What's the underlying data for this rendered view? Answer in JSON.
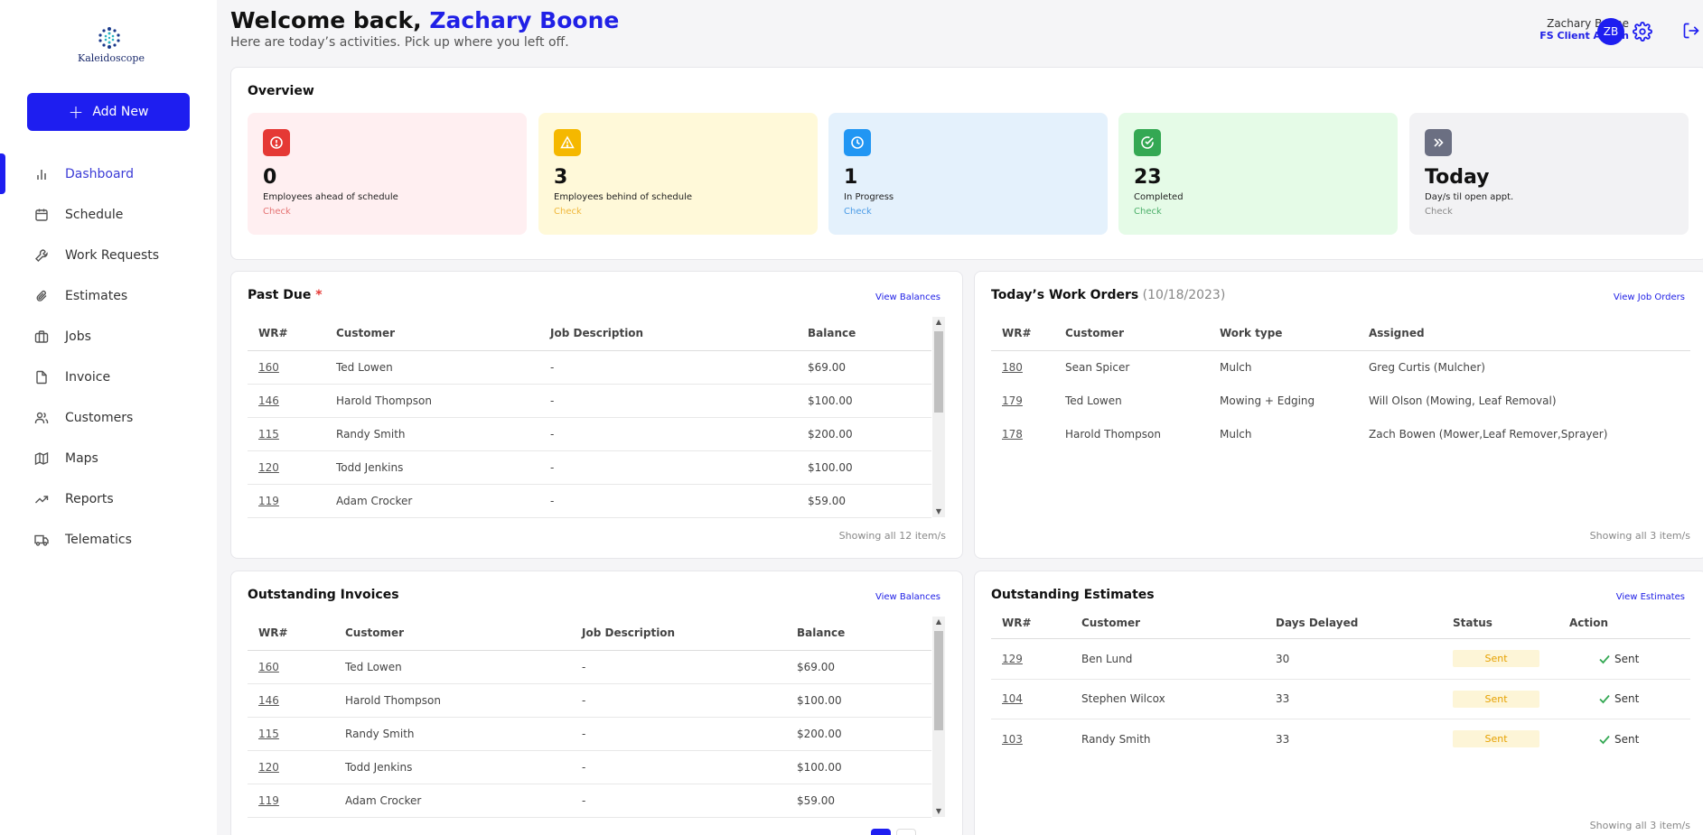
{
  "app": {
    "logo_text": "Kaleidoscope"
  },
  "sidebar": {
    "add_new_label": "Add New",
    "items": [
      {
        "label": "Dashboard",
        "icon": "bar-chart-icon"
      },
      {
        "label": "Schedule",
        "icon": "calendar-icon"
      },
      {
        "label": "Work Requests",
        "icon": "wrench-icon"
      },
      {
        "label": "Estimates",
        "icon": "paperclip-icon"
      },
      {
        "label": "Jobs",
        "icon": "briefcase-icon"
      },
      {
        "label": "Invoice",
        "icon": "file-icon"
      },
      {
        "label": "Customers",
        "icon": "users-icon"
      },
      {
        "label": "Maps",
        "icon": "map-icon"
      },
      {
        "label": "Reports",
        "icon": "trending-up-icon"
      },
      {
        "label": "Telematics",
        "icon": "truck-icon"
      }
    ]
  },
  "header": {
    "welcome": "Welcome back,",
    "name": "Zachary Boone",
    "subtitle": "Here are today’s activities. Pick up where you left off.",
    "user_name": "Zachary Boone",
    "user_role": "FS Client Admin",
    "avatar": "ZB"
  },
  "overview": {
    "title": "Overview",
    "cards": [
      {
        "value": "0",
        "label": "Employees ahead of schedule",
        "link": "Check",
        "bg": "#ffeff1",
        "icon_bg": "#e53935",
        "link_color": "#e57373",
        "icon": "alert-circle-icon"
      },
      {
        "value": "3",
        "label": "Employees behind of schedule",
        "link": "Check",
        "bg": "#fff9d9",
        "icon_bg": "#f5b800",
        "link_color": "#f0b73a",
        "icon": "warning-icon"
      },
      {
        "value": "1",
        "label": "In Progress",
        "link": "Check",
        "bg": "#e4f1fc",
        "icon_bg": "#2196f3",
        "link_color": "#4a9be6",
        "icon": "clock-icon"
      },
      {
        "value": "23",
        "label": "Completed",
        "link": "Check",
        "bg": "#e5fbe7",
        "icon_bg": "#34a853",
        "link_color": "#4caf6a",
        "icon": "check-circle-icon"
      },
      {
        "value": "Today",
        "label": "Day/s til open appt.",
        "link": "Check",
        "bg": "#f2f2f4",
        "icon_bg": "#6b6f82",
        "link_color": "#888888",
        "icon": "chevrons-right-icon"
      }
    ]
  },
  "past_due": {
    "title": "Past Due",
    "star": "*",
    "link": "View Balances",
    "columns": [
      "WR#",
      "Customer",
      "Job Description",
      "Balance"
    ],
    "rows": [
      [
        "160",
        "Ted Lowen",
        "-",
        "$69.00"
      ],
      [
        "146",
        "Harold Thompson",
        "-",
        "$100.00"
      ],
      [
        "115",
        "Randy Smith",
        "-",
        "$200.00"
      ],
      [
        "120",
        "Todd Jenkins",
        "-",
        "$100.00"
      ],
      [
        "119",
        "Adam Crocker",
        "-",
        "$59.00"
      ]
    ],
    "showing": "Showing all 12 item/s"
  },
  "work_orders": {
    "title": "Today’s Work Orders",
    "date": "(10/18/2023)",
    "link": "View Job Orders",
    "columns": [
      "WR#",
      "Customer",
      "Work type",
      "Assigned"
    ],
    "rows": [
      [
        "180",
        "Sean Spicer",
        "Mulch",
        "Greg Curtis (Mulcher)"
      ],
      [
        "179",
        "Ted Lowen",
        "Mowing + Edging",
        "Will Olson (Mowing, Leaf Removal)"
      ],
      [
        "178",
        "Harold Thompson",
        "Mulch",
        "Zach Bowen (Mower,Leaf Remover,Sprayer)"
      ]
    ],
    "showing": "Showing all 3 item/s"
  },
  "invoices": {
    "title": "Outstanding Invoices",
    "link": "View Balances",
    "columns": [
      "WR#",
      "Customer",
      "Job Description",
      "Balance"
    ],
    "rows": [
      [
        "160",
        "Ted Lowen",
        "-",
        "$69.00"
      ],
      [
        "146",
        "Harold Thompson",
        "-",
        "$100.00"
      ],
      [
        "115",
        "Randy Smith",
        "-",
        "$200.00"
      ],
      [
        "120",
        "Todd Jenkins",
        "-",
        "$100.00"
      ],
      [
        "119",
        "Adam Crocker",
        "-",
        "$59.00"
      ]
    ]
  },
  "estimates": {
    "title": "Outstanding Estimates",
    "link": "View Estimates",
    "columns": [
      "WR#",
      "Customer",
      "Days Delayed",
      "Status",
      "Action"
    ],
    "rows": [
      [
        "129",
        "Ben Lund",
        "30",
        "Sent",
        "Sent"
      ],
      [
        "104",
        "Stephen Wilcox",
        "33",
        "Sent",
        "Sent"
      ],
      [
        "103",
        "Randy Smith",
        "33",
        "Sent",
        "Sent"
      ]
    ],
    "showing": "Showing all 3 item/s"
  }
}
